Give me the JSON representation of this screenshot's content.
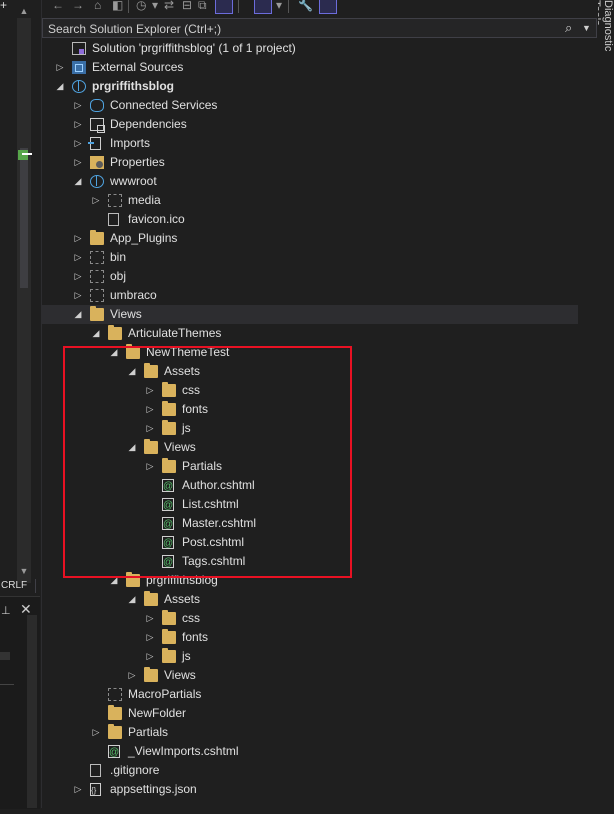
{
  "status": {
    "line_ending": "CRLF"
  },
  "right_panel": {
    "label": "Diagnostic Tools"
  },
  "explorer": {
    "search_placeholder": "Search Solution Explorer (Ctrl+;)",
    "tree": [
      {
        "label": "Solution 'prgriffithsblog' (1 of 1 project)",
        "level": 0,
        "arrow": "",
        "icon": "solution-icon",
        "bold": false
      },
      {
        "label": "External Sources",
        "level": 0,
        "arrow": "collapsed",
        "icon": "external-sources-icon",
        "bold": false
      },
      {
        "label": "prgriffithsblog",
        "level": 0,
        "arrow": "expanded",
        "icon": "web-project-icon",
        "bold": true
      },
      {
        "label": "Connected Services",
        "level": 1,
        "arrow": "collapsed",
        "icon": "connected-services-icon",
        "bold": false
      },
      {
        "label": "Dependencies",
        "level": 1,
        "arrow": "collapsed",
        "icon": "dependencies-icon",
        "bold": false
      },
      {
        "label": "Imports",
        "level": 1,
        "arrow": "collapsed",
        "icon": "imports-icon",
        "bold": false
      },
      {
        "label": "Properties",
        "level": 1,
        "arrow": "collapsed",
        "icon": "properties-icon",
        "bold": false
      },
      {
        "label": "wwwroot",
        "level": 1,
        "arrow": "expanded",
        "icon": "web-root-icon",
        "bold": false
      },
      {
        "label": "media",
        "level": 2,
        "arrow": "collapsed",
        "icon": "excluded-folder-icon",
        "bold": false
      },
      {
        "label": "favicon.ico",
        "level": 2,
        "arrow": "",
        "icon": "file-icon",
        "bold": false
      },
      {
        "label": "App_Plugins",
        "level": 1,
        "arrow": "collapsed",
        "icon": "folder-icon",
        "bold": false
      },
      {
        "label": "bin",
        "level": 1,
        "arrow": "collapsed",
        "icon": "excluded-folder-icon",
        "bold": false
      },
      {
        "label": "obj",
        "level": 1,
        "arrow": "collapsed",
        "icon": "excluded-folder-icon",
        "bold": false
      },
      {
        "label": "umbraco",
        "level": 1,
        "arrow": "collapsed",
        "icon": "excluded-folder-icon",
        "bold": false
      },
      {
        "label": "Views",
        "level": 1,
        "arrow": "expanded",
        "icon": "folder-icon",
        "bold": false,
        "selected": true
      },
      {
        "label": "ArticulateThemes",
        "level": 2,
        "arrow": "expanded",
        "icon": "folder-icon",
        "bold": false
      },
      {
        "label": "NewThemeTest",
        "level": 3,
        "arrow": "expanded",
        "icon": "folder-icon",
        "bold": false
      },
      {
        "label": "Assets",
        "level": 4,
        "arrow": "expanded",
        "icon": "folder-icon",
        "bold": false
      },
      {
        "label": "css",
        "level": 5,
        "arrow": "collapsed",
        "icon": "folder-icon",
        "bold": false
      },
      {
        "label": "fonts",
        "level": 5,
        "arrow": "collapsed",
        "icon": "folder-icon",
        "bold": false
      },
      {
        "label": "js",
        "level": 5,
        "arrow": "collapsed",
        "icon": "folder-icon",
        "bold": false
      },
      {
        "label": "Views",
        "level": 4,
        "arrow": "expanded",
        "icon": "folder-icon",
        "bold": false
      },
      {
        "label": "Partials",
        "level": 5,
        "arrow": "collapsed",
        "icon": "folder-icon",
        "bold": false
      },
      {
        "label": "Author.cshtml",
        "level": 5,
        "arrow": "",
        "icon": "cshtml-file-icon",
        "bold": false
      },
      {
        "label": "List.cshtml",
        "level": 5,
        "arrow": "",
        "icon": "cshtml-file-icon",
        "bold": false
      },
      {
        "label": "Master.cshtml",
        "level": 5,
        "arrow": "",
        "icon": "cshtml-file-icon",
        "bold": false
      },
      {
        "label": "Post.cshtml",
        "level": 5,
        "arrow": "",
        "icon": "cshtml-file-icon",
        "bold": false
      },
      {
        "label": "Tags.cshtml",
        "level": 5,
        "arrow": "",
        "icon": "cshtml-file-icon",
        "bold": false
      },
      {
        "label": "prgriffithsblog",
        "level": 3,
        "arrow": "expanded",
        "icon": "folder-icon",
        "bold": false
      },
      {
        "label": "Assets",
        "level": 4,
        "arrow": "expanded",
        "icon": "folder-icon",
        "bold": false
      },
      {
        "label": "css",
        "level": 5,
        "arrow": "collapsed",
        "icon": "folder-icon",
        "bold": false
      },
      {
        "label": "fonts",
        "level": 5,
        "arrow": "collapsed",
        "icon": "folder-icon",
        "bold": false
      },
      {
        "label": "js",
        "level": 5,
        "arrow": "collapsed",
        "icon": "folder-icon",
        "bold": false
      },
      {
        "label": "Views",
        "level": 4,
        "arrow": "collapsed",
        "icon": "folder-icon",
        "bold": false
      },
      {
        "label": "MacroPartials",
        "level": 2,
        "arrow": "",
        "icon": "excluded-folder-icon",
        "bold": false
      },
      {
        "label": "NewFolder",
        "level": 2,
        "arrow": "",
        "icon": "folder-icon",
        "bold": false
      },
      {
        "label": "Partials",
        "level": 2,
        "arrow": "collapsed",
        "icon": "folder-icon",
        "bold": false
      },
      {
        "label": "_ViewImports.cshtml",
        "level": 2,
        "arrow": "",
        "icon": "cshtml-file-icon",
        "bold": false
      },
      {
        "label": ".gitignore",
        "level": 1,
        "arrow": "",
        "icon": "file-icon",
        "bold": false
      },
      {
        "label": "appsettings.json",
        "level": 1,
        "arrow": "collapsed",
        "icon": "json-file-icon",
        "bold": false
      }
    ]
  },
  "colors": {
    "highlight_box": "#e81123",
    "folder": "#d9b25c",
    "selected_row": "#2d2d30"
  }
}
